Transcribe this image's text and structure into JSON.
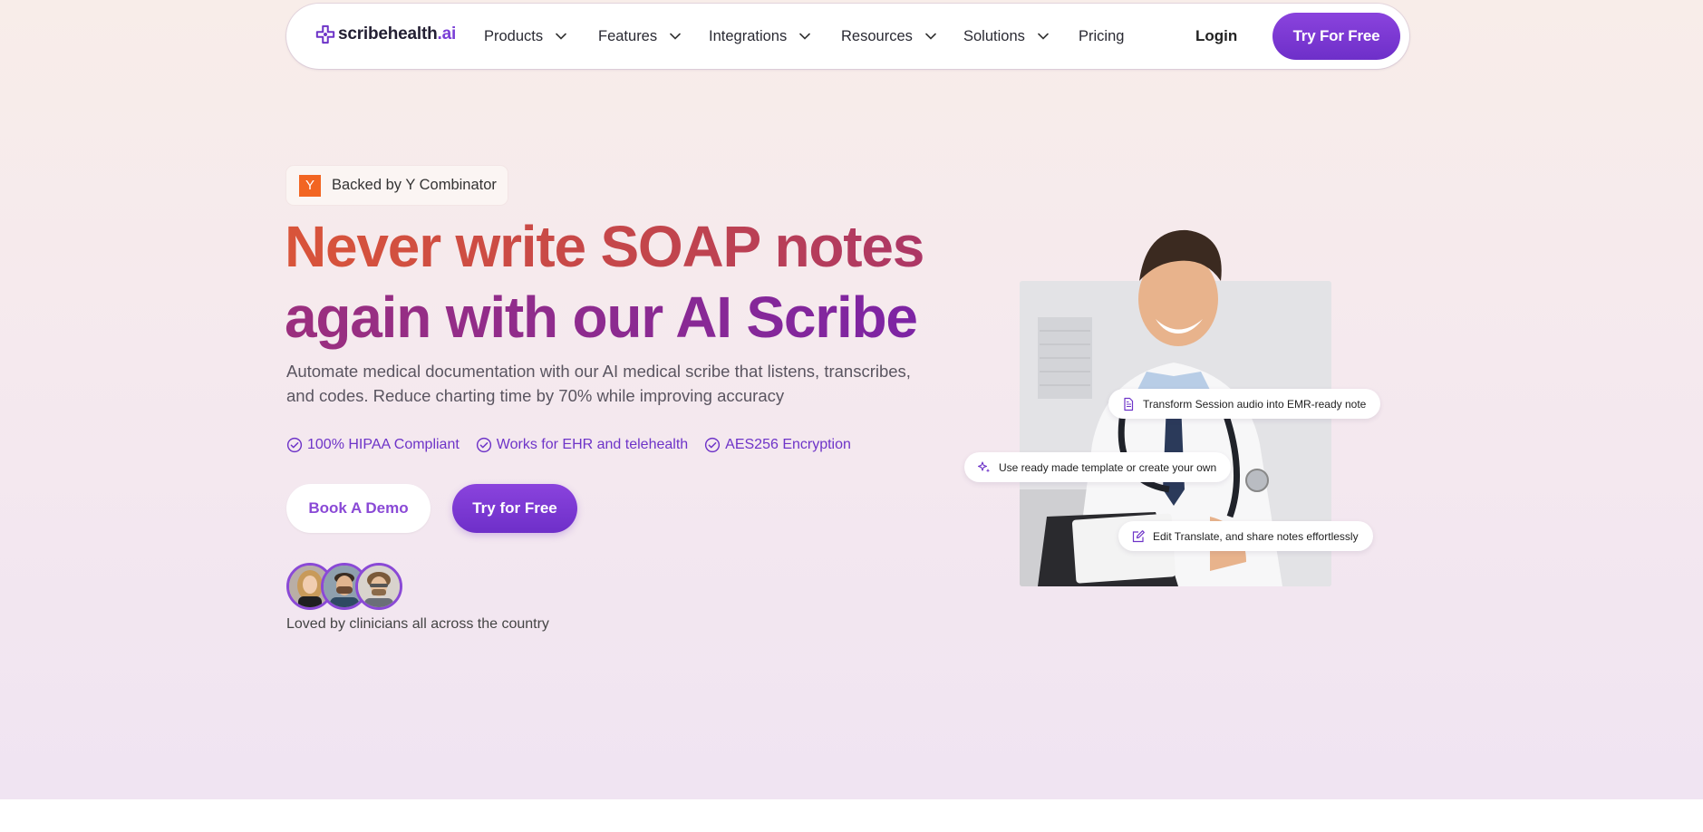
{
  "colors": {
    "brand_purple": "#7a3fd6",
    "headline_start": "#d9543a",
    "headline_end": "#7a22a8",
    "yc_orange": "#f26522"
  },
  "nav": {
    "logo_text": "scribehealth",
    "logo_suffix": ".ai",
    "items": [
      {
        "label": "Products",
        "has_dropdown": true
      },
      {
        "label": "Features",
        "has_dropdown": true
      },
      {
        "label": "Integrations",
        "has_dropdown": true
      },
      {
        "label": "Resources",
        "has_dropdown": true
      },
      {
        "label": "Solutions",
        "has_dropdown": true
      },
      {
        "label": "Pricing",
        "has_dropdown": false
      }
    ],
    "login": "Login",
    "cta": "Try For Free"
  },
  "hero": {
    "badge": {
      "logo": "Y",
      "text": "Backed by Y Combinator"
    },
    "headline_line1": "Never write SOAP notes",
    "headline_line2": "again with our AI Scribe",
    "subtitle": "Automate medical documentation with our AI medical scribe that listens, transcribes, and codes. Reduce charting time by 70% while improving accuracy",
    "features": [
      {
        "icon": "check-circle-icon",
        "label": "100% HIPAA Compliant"
      },
      {
        "icon": "check-circle-icon",
        "label": "Works for EHR and telehealth"
      },
      {
        "icon": "check-circle-icon",
        "label": "AES256 Encryption"
      }
    ],
    "demo_button": "Book A Demo",
    "try_button": "Try for Free",
    "social_proof": "Loved by clinicians all across the country"
  },
  "illustration": {
    "chips": [
      {
        "icon": "document-icon",
        "text": "Transform Session audio into EMR-ready note"
      },
      {
        "icon": "sparkle-icon",
        "text": "Use ready made template or create your own"
      },
      {
        "icon": "edit-icon",
        "text": "Edit Translate, and share notes effortlessly"
      }
    ]
  }
}
